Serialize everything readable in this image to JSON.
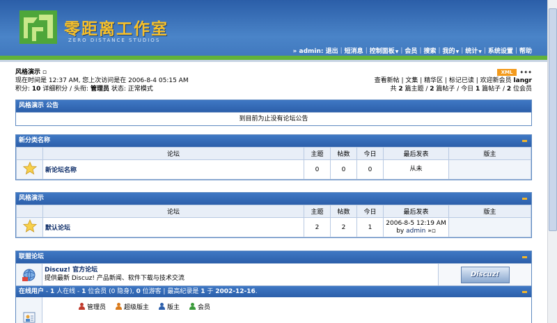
{
  "header": {
    "logo_cn": "零距离工作室",
    "logo_en": "ZERO DISTANCE STUDIOS",
    "nav": [
      {
        "label": "» admin: 退出",
        "caret": false
      },
      {
        "label": "短消息",
        "caret": false
      },
      {
        "label": "控制面板",
        "caret": true
      },
      {
        "label": "会员",
        "caret": false
      },
      {
        "label": "搜索",
        "caret": false
      },
      {
        "label": "我的",
        "caret": true
      },
      {
        "label": "统计",
        "caret": true
      },
      {
        "label": "系统设置",
        "caret": false
      },
      {
        "label": "帮助",
        "caret": false
      }
    ]
  },
  "info": {
    "breadcrumb": "风格演示",
    "xml": "XML",
    "visit_text": "现在时间是 12:37 AM, 您上次访问是在 2006-8-4 05:15 AM",
    "credits_label": "积分: ",
    "credits_value": "10",
    "credits_rest": " 详细积分 / 头衔: ",
    "title_value": "管理员",
    "status_text": " 状态: 正常模式",
    "links": "查看新帖 | 文集 | 精华区 | 标记已读 | 欢迎新会员",
    "new_member": "langr",
    "stats_a": "共 ",
    "stats_b": "2",
    "stats_c": " 篇主题 / ",
    "stats_d": "2",
    "stats_e": " 篇帖子 / 今日 ",
    "stats_f": "1",
    "stats_g": " 篇帖子 / ",
    "stats_h": "2",
    "stats_i": " 位会员"
  },
  "announce": {
    "title": "风格演示 公告",
    "body": "到目前为止没有论坛公告"
  },
  "columns": {
    "forum": "论坛",
    "topics": "主题",
    "posts": "帖数",
    "today": "今日",
    "last": "最后发表",
    "mod": "版主"
  },
  "cat1": {
    "title": "新分类名称",
    "forum_name": "新论坛名称",
    "topics": "0",
    "posts": "0",
    "today": "0",
    "last": "从未",
    "mod": ""
  },
  "cat2": {
    "title": "风格演示",
    "forum_name": "默认论坛",
    "topics": "2",
    "posts": "2",
    "today": "1",
    "last_time": "2006-8-5 12:19 AM",
    "last_by": "by ",
    "last_user": "admin",
    "mod": ""
  },
  "alliance": {
    "title": "联盟论坛",
    "name": "Discuz! 官方论坛",
    "desc": "提供最新 Discuz! 产品新闻、软件下载与技术交流",
    "logo": "Discuz!"
  },
  "online": {
    "label": "在线用户",
    "sep": " - ",
    "total": "1",
    "t1": " 人在线 - ",
    "members": "1",
    "t2": " 位会员 (0 隐身), ",
    "guests": "0",
    "t3": " 位游客 | 最高纪录是 ",
    "record": "1",
    "t4": " 于 ",
    "record_date": "2002-12-16",
    "t5": ".",
    "legend": [
      {
        "label": "管理员",
        "color": "#c0392b"
      },
      {
        "label": "超级版主",
        "color": "#d97a1b"
      },
      {
        "label": "版主",
        "color": "#2c5fab"
      },
      {
        "label": "会员",
        "color": "#3a9a3a"
      }
    ]
  }
}
